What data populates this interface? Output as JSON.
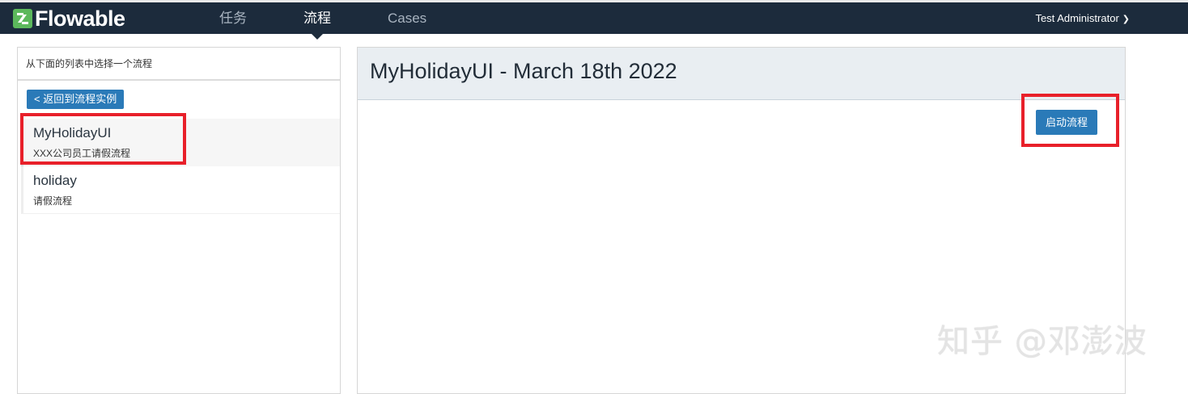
{
  "navbar": {
    "logo_text": "Flowable",
    "items": [
      {
        "label": "任务",
        "active": false
      },
      {
        "label": "流程",
        "active": true
      },
      {
        "label": "Cases",
        "active": false
      }
    ],
    "user": "Test Administrator"
  },
  "left": {
    "header": "从下面的列表中选择一个流程",
    "back_button": "< 返回到流程实例",
    "processes": [
      {
        "name": "MyHolidayUI",
        "description": "XXX公司员工请假流程",
        "selected": true
      },
      {
        "name": "holiday",
        "description": "请假流程",
        "selected": false
      }
    ]
  },
  "right": {
    "title": "MyHolidayUI - March 18th 2022",
    "start_button": "启动流程"
  },
  "watermark": "知乎 @邓澎波",
  "colors": {
    "navbar_bg": "#1c2b3c",
    "primary_button": "#2a7ab8",
    "logo_green": "#5cb85c",
    "annotation_red": "#e8202a",
    "header_bg": "#e9eef2"
  }
}
